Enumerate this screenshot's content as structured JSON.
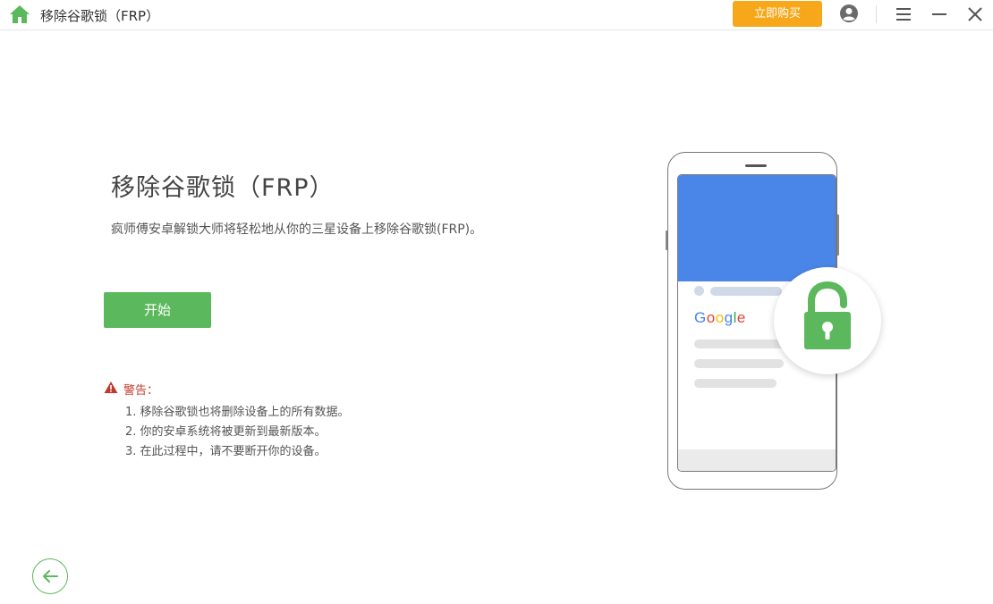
{
  "window": {
    "title": "移除谷歌锁（FRP）",
    "buy_label": "立即购买"
  },
  "main": {
    "heading": "移除谷歌锁（FRP）",
    "description": "疯师傅安卓解锁大师将轻松地从你的三星设备上移除谷歌锁(FRP)。",
    "start_label": "开始",
    "warning": {
      "label": "警告：",
      "items": [
        "1. 移除谷歌锁也将删除设备上的所有数据。",
        "2. 你的安卓系统将被更新到最新版本。",
        "3. 在此过程中，请不要断开你的设备。"
      ]
    }
  },
  "illustration": {
    "google_text": "Google"
  },
  "colors": {
    "accent_green": "#5cb85c",
    "buy_orange": "#f7a71a",
    "warning_red": "#c0392b",
    "screen_blue": "#4a86e8"
  },
  "icons": {
    "home": "home-icon",
    "user": "user-icon",
    "menu": "menu-icon",
    "minimize": "minimize-icon",
    "close": "close-icon",
    "warning": "warning-icon",
    "lock": "unlock-icon",
    "back": "arrow-left-icon"
  }
}
